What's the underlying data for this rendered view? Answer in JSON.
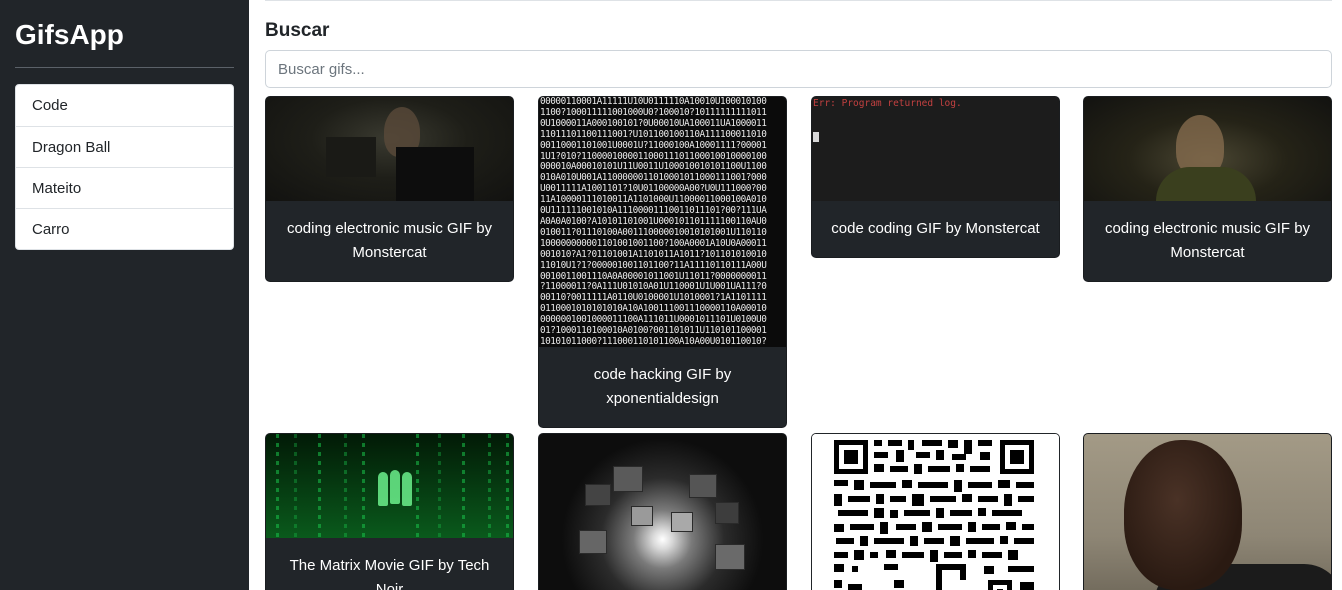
{
  "app": {
    "brand": "GifsApp"
  },
  "sidebar": {
    "history": [
      {
        "label": "Code"
      },
      {
        "label": "Dragon Ball"
      },
      {
        "label": "Mateito"
      },
      {
        "label": "Carro"
      }
    ]
  },
  "search": {
    "title": "Buscar",
    "placeholder": "Buscar gifs..."
  },
  "gifs": [
    {
      "title": "coding electronic music GIF by Monstercat"
    },
    {
      "title": "code hacking GIF by xponentialdesign"
    },
    {
      "title": "code coding GIF by Monstercat"
    },
    {
      "title": "coding electronic music GIF by Monstercat"
    },
    {
      "title": "The Matrix Movie GIF by Tech Noir"
    },
    {
      "title": ""
    },
    {
      "title": ""
    },
    {
      "title": ""
    }
  ],
  "thumbnails": {
    "terminal_error": "Err: Program returned log."
  },
  "colors": {
    "sidebar_bg": "#212529",
    "card_bg": "#212529",
    "accent_text": "#ffffff"
  }
}
